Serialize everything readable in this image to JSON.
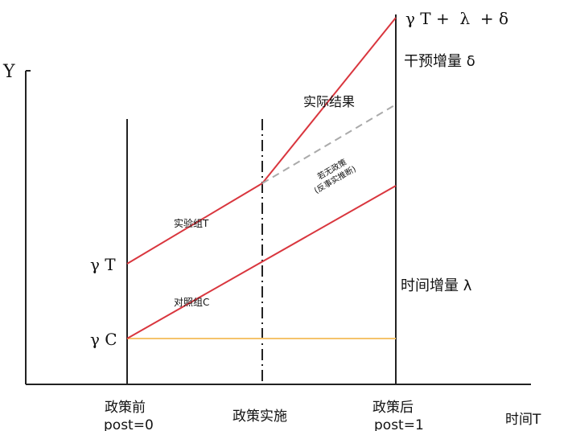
{
  "axes": {
    "y_label": "Y",
    "x_label": "时间T"
  },
  "ticks": {
    "pre": "政策前",
    "pre_post": "post=0",
    "mid": "政策实施",
    "post": "政策后",
    "post_post": "post=1"
  },
  "levels": {
    "gamma_t": "γ T",
    "gamma_c": "γ C",
    "top": "γ T +  λ  + δ"
  },
  "increments": {
    "intervention": "干预增量 δ",
    "time": "时间增量 λ"
  },
  "lines": {
    "treatment": "实验组T",
    "control": "对照组C",
    "actual": "实际结果",
    "counterfactual_1": "若无政策",
    "counterfactual_2": "(反事实推断)"
  },
  "colors": {
    "treatment": "#d9363e",
    "control": "#d9363e",
    "counterfactual": "#aaaaaa",
    "baseline": "#f5c36b",
    "axis": "#222222"
  }
}
